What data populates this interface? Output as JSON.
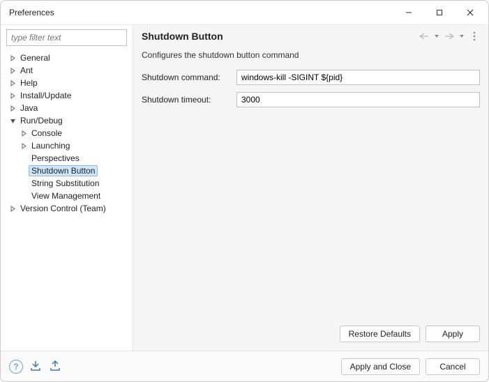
{
  "window": {
    "title": "Preferences"
  },
  "filter": {
    "placeholder": "type filter text"
  },
  "tree": {
    "items": [
      {
        "label": "General",
        "depth": 0,
        "twisty": "closed",
        "selected": false
      },
      {
        "label": "Ant",
        "depth": 0,
        "twisty": "closed",
        "selected": false
      },
      {
        "label": "Help",
        "depth": 0,
        "twisty": "closed",
        "selected": false
      },
      {
        "label": "Install/Update",
        "depth": 0,
        "twisty": "closed",
        "selected": false
      },
      {
        "label": "Java",
        "depth": 0,
        "twisty": "closed",
        "selected": false
      },
      {
        "label": "Run/Debug",
        "depth": 0,
        "twisty": "open",
        "selected": false
      },
      {
        "label": "Console",
        "depth": 1,
        "twisty": "closed",
        "selected": false
      },
      {
        "label": "Launching",
        "depth": 1,
        "twisty": "closed",
        "selected": false
      },
      {
        "label": "Perspectives",
        "depth": 1,
        "twisty": "none",
        "selected": false
      },
      {
        "label": "Shutdown Button",
        "depth": 1,
        "twisty": "none",
        "selected": true
      },
      {
        "label": "String Substitution",
        "depth": 1,
        "twisty": "none",
        "selected": false
      },
      {
        "label": "View Management",
        "depth": 1,
        "twisty": "none",
        "selected": false
      },
      {
        "label": "Version Control (Team)",
        "depth": 0,
        "twisty": "closed",
        "selected": false
      }
    ]
  },
  "page": {
    "title": "Shutdown Button",
    "description": "Configures the shutdown button command",
    "fields": {
      "command": {
        "label": "Shutdown command:",
        "value": "windows-kill -SIGINT ${pid}"
      },
      "timeout": {
        "label": "Shutdown timeout:",
        "value": "3000"
      }
    },
    "buttons": {
      "restore": "Restore Defaults",
      "apply": "Apply"
    }
  },
  "footer": {
    "apply_close": "Apply and Close",
    "cancel": "Cancel"
  }
}
